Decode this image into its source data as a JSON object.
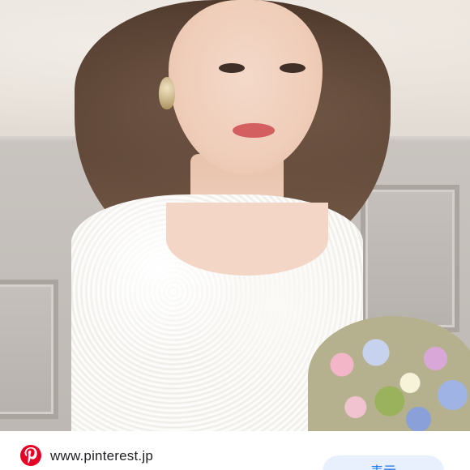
{
  "photo": {
    "icon": "bride-photo"
  },
  "source": {
    "site_icon": "pinterest-icon",
    "site_color": "#e60023",
    "url": "www.pinterest.jp"
  },
  "actions": {
    "view_label": "表示",
    "view_color": "#1a73e8"
  }
}
